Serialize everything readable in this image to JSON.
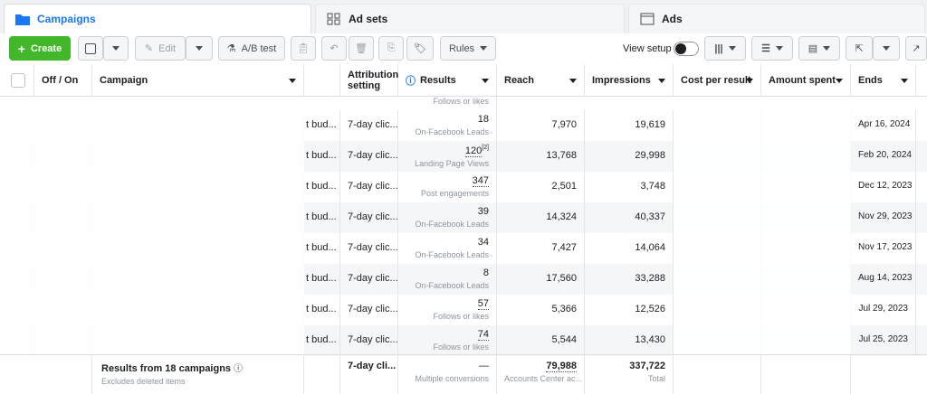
{
  "tabs": [
    {
      "label": "Campaigns"
    },
    {
      "label": "Ad sets"
    },
    {
      "label": "Ads"
    }
  ],
  "toolbar": {
    "create": "Create",
    "edit": "Edit",
    "ab_test": "A/B test",
    "rules": "Rules",
    "view_setup": "View setup"
  },
  "columns": [
    "Off / On",
    "Campaign",
    "Attribution setting",
    "Results",
    "Reach",
    "Impressions",
    "Cost per result",
    "Amount spent",
    "Ends"
  ],
  "top_row": {
    "result_label": "Follows or likes"
  },
  "rows": [
    {
      "budget": "t bud...",
      "attribution": "7-day clic...",
      "result": "18",
      "result_type": "On-Facebook Leads",
      "reach": "7,970",
      "impressions": "19,619",
      "ends": "Apr 16, 2024"
    },
    {
      "budget": "t bud...",
      "attribution": "7-day clic...",
      "result": "120",
      "result_sup": "[2]",
      "result_type": "Landing Page Views",
      "reach": "13,768",
      "impressions": "29,998",
      "ends": "Feb 20, 2024"
    },
    {
      "budget": "t bud...",
      "attribution": "7-day clic...",
      "result": "347",
      "result_type": "Post engagements",
      "reach": "2,501",
      "impressions": "3,748",
      "ends": "Dec 12, 2023"
    },
    {
      "budget": "t bud...",
      "attribution": "7-day clic...",
      "result": "39",
      "result_type": "On-Facebook Leads",
      "reach": "14,324",
      "impressions": "40,337",
      "ends": "Nov 29, 2023"
    },
    {
      "budget": "t bud...",
      "attribution": "7-day clic...",
      "result": "34",
      "result_type": "On-Facebook Leads",
      "reach": "7,427",
      "impressions": "14,064",
      "ends": "Nov 17, 2023"
    },
    {
      "budget": "t bud...",
      "attribution": "7-day clic...",
      "result": "8",
      "result_type": "On-Facebook Leads",
      "reach": "17,560",
      "impressions": "33,288",
      "ends": "Aug 14, 2023"
    },
    {
      "budget": "t bud...",
      "attribution": "7-day clic...",
      "result": "57",
      "result_type": "Follows or likes",
      "reach": "5,366",
      "impressions": "12,526",
      "ends": "Jul 29, 2023"
    },
    {
      "budget": "t bud...",
      "attribution": "7-day clic...",
      "result": "74",
      "result_type": "Follows or likes",
      "reach": "5,544",
      "impressions": "13,430",
      "ends": "Jul 25, 2023"
    }
  ],
  "footer": {
    "title": "Results from 18 campaigns",
    "subtitle": "Excludes deleted items",
    "attribution": "7-day cli...",
    "results": "—",
    "results_sub": "Multiple conversions",
    "reach": "79,988",
    "reach_sub": "Accounts Center ac...",
    "impressions": "337,722",
    "impressions_sub": "Total"
  },
  "colors": {
    "accent": "#1877f2",
    "green": "#42b72a"
  }
}
